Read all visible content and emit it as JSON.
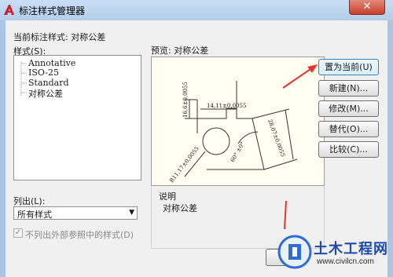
{
  "window": {
    "title": "标注样式管理器",
    "close_glyph": "✕"
  },
  "current_style_label": "当前标注样式: 对称公差",
  "styles": {
    "label": "样式(S):",
    "items": [
      "Annotative",
      "ISO-25",
      "Standard",
      "对称公差"
    ]
  },
  "preview": {
    "label": "预览: 对称公差",
    "dims": [
      "14,11±0,0055",
      "16,6±0,0055",
      "28,07±0,0055",
      "R11,17±0,0055",
      "60°  ±0°"
    ]
  },
  "list": {
    "label": "列出(L):",
    "selected": "所有样式"
  },
  "checkbox": {
    "label": "不列出外部参照中的样式(D)",
    "checked": true
  },
  "buttons": {
    "set_current": "置为当前(U)",
    "new": "新建(N)...",
    "modify": "修改(M)...",
    "override": "替代(O)...",
    "compare": "比较(C)..."
  },
  "description": {
    "label": "说明",
    "text": "对称公差"
  },
  "watermark": {
    "name": "土木工程网",
    "url": "www.civilcn.com"
  }
}
